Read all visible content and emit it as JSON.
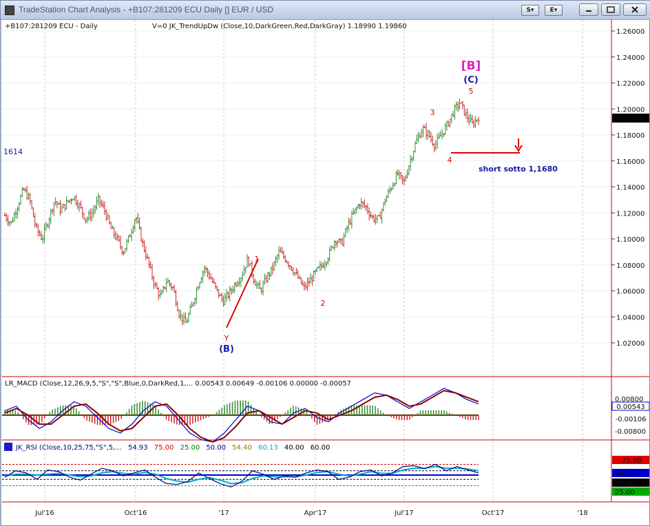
{
  "window": {
    "title": "TradeStation Chart Analysis - +B107:281209 ECU Daily [] EUR / USD",
    "buttons": [
      "S",
      "E"
    ]
  },
  "price_panel": {
    "symbol_label": "+B107:281209 ECU - Daily",
    "indicator_label": "V=0  JK_TrendUpDw (Close,10,DarkGreen,Red,DarkGray)   1.18990  1.19860",
    "left_label": "1614",
    "y_ticks": [
      "1.26000",
      "1.24000",
      "1.22000",
      "1.20000",
      "1.18000",
      "1.16000",
      "1.14000",
      "1.12000",
      "1.10000",
      "1.08000",
      "1.06000",
      "1.04000",
      "1.02000"
    ],
    "last_price": "1.19410",
    "annotations": {
      "big_b": "[B]",
      "wave_c": "(C)",
      "wave_b": "(B)",
      "y": "Y",
      "w1": "1",
      "w2": "2",
      "w3": "3",
      "w4": "4",
      "w5": "5",
      "short_text": "short sotto 1,1680"
    }
  },
  "macd_panel": {
    "label": "LR_MACD (Close,12,26,9,5,\"S\",\"S\",Blue,0,DarkRed,1,...   0.00543   0.00649   -0.00106   0.00000   -0.00057",
    "y_ticks": [
      "0.00800",
      "-0.00800"
    ],
    "value_badges": [
      {
        "text": "0.00543",
        "color": "#0000cc"
      },
      {
        "text": "-0.00106",
        "color": "#cc0000"
      }
    ]
  },
  "rsi_panel": {
    "label_parts": [
      {
        "text": "JK_RSI (Close,10,25,75,\"S\",5,...",
        "color": "#000080"
      },
      {
        "text": "54.93",
        "color": "#000080"
      },
      {
        "text": "75.00",
        "color": "#cc0000"
      },
      {
        "text": "25.00",
        "color": "#007700"
      },
      {
        "text": "50.00",
        "color": "#000080"
      },
      {
        "text": "54.40",
        "color": "#808000"
      },
      {
        "text": "60.13",
        "color": "#00aacc"
      },
      {
        "text": "40.00",
        "color": "#000000"
      },
      {
        "text": "60.00",
        "color": "#000000"
      }
    ],
    "value_badges": [
      {
        "text": "75.00",
        "color": "#cc0000"
      },
      {
        "text": "54.93",
        "color": "#0000cc"
      },
      {
        "text": "40.00",
        "color": "#000000"
      },
      {
        "text": "25.00",
        "color": "#007700"
      }
    ]
  },
  "x_axis": {
    "labels": [
      "Jul'16",
      "Oct'16",
      "'17",
      "Apr'17",
      "Jul'17",
      "Oct'17",
      "'18"
    ]
  },
  "chart_data": {
    "type": "ohlc",
    "title": "+B107:281209 ECU - Daily",
    "ylim": [
      1.0,
      1.265
    ],
    "x_labels": [
      "Jul'16",
      "Oct'16",
      "'17",
      "Apr'17",
      "Jul'17",
      "Oct'17",
      "'18"
    ],
    "y_ticks": [
      1.26,
      1.24,
      1.22,
      1.2,
      1.18,
      1.16,
      1.14,
      1.12,
      1.1,
      1.08,
      1.06,
      1.04,
      1.02
    ],
    "last_price": 1.1941,
    "close_path": [
      1.118,
      1.112,
      1.125,
      1.138,
      1.13,
      1.108,
      1.1,
      1.115,
      1.13,
      1.122,
      1.128,
      1.133,
      1.125,
      1.115,
      1.12,
      1.13,
      1.122,
      1.108,
      1.1,
      1.09,
      1.102,
      1.118,
      1.098,
      1.082,
      1.065,
      1.055,
      1.068,
      1.062,
      1.042,
      1.035,
      1.048,
      1.065,
      1.078,
      1.07,
      1.06,
      1.052,
      1.058,
      1.066,
      1.072,
      1.085,
      1.068,
      1.06,
      1.07,
      1.078,
      1.09,
      1.085,
      1.078,
      1.07,
      1.062,
      1.068,
      1.075,
      1.08,
      1.088,
      1.1,
      1.096,
      1.11,
      1.12,
      1.128,
      1.124,
      1.116,
      1.115,
      1.13,
      1.14,
      1.15,
      1.143,
      1.16,
      1.175,
      1.185,
      1.18,
      1.172,
      1.18,
      1.188,
      1.198,
      1.205,
      1.195,
      1.188,
      1.194
    ],
    "levels": [
      {
        "label": "short sotto 1,1680",
        "value": 1.168
      }
    ],
    "wave_labels": [
      {
        "text": "Y",
        "value": 1.037
      },
      {
        "text": "(B)",
        "value": 1.035
      },
      {
        "text": "1",
        "value": 1.083
      },
      {
        "text": "2",
        "value": 1.058
      },
      {
        "text": "3",
        "value": 1.192
      },
      {
        "text": "4",
        "value": 1.168
      },
      {
        "text": "5",
        "value": 1.205
      },
      {
        "text": "(C)",
        "value": 1.205
      },
      {
        "text": "[B]",
        "value": 1.205
      }
    ],
    "macd": {
      "label_values": [
        0.00543,
        0.00649,
        -0.00106,
        0.0,
        -0.00057
      ],
      "ylim": [
        -0.0105,
        0.0105
      ],
      "series": [
        {
          "name": "MACD",
          "color": "#0000cc",
          "values": [
            0.002,
            0.004,
            -0.002,
            -0.006,
            -0.003,
            0.002,
            0.006,
            0.004,
            -0.001,
            -0.006,
            -0.008,
            -0.004,
            0.002,
            0.006,
            0.004,
            -0.002,
            -0.008,
            -0.011,
            -0.012,
            -0.008,
            -0.002,
            0.004,
            0.002,
            -0.003,
            -0.004,
            0.001,
            0.003,
            -0.001,
            -0.003,
            0.001,
            0.004,
            0.007,
            0.01,
            0.009,
            0.006,
            0.003,
            0.006,
            0.009,
            0.012,
            0.01,
            0.007,
            0.005
          ]
        },
        {
          "name": "Signal",
          "color": "#8b0000",
          "values": [
            0.001,
            0.003,
            0.0,
            -0.004,
            -0.004,
            0.0,
            0.004,
            0.005,
            0.001,
            -0.004,
            -0.007,
            -0.006,
            -0.001,
            0.004,
            0.005,
            0.0,
            -0.006,
            -0.01,
            -0.012,
            -0.01,
            -0.005,
            0.001,
            0.002,
            -0.001,
            -0.004,
            -0.001,
            0.002,
            0.001,
            -0.002,
            0.0,
            0.002,
            0.005,
            0.008,
            0.009,
            0.007,
            0.004,
            0.005,
            0.008,
            0.011,
            0.01,
            0.008,
            0.006
          ]
        }
      ]
    },
    "rsi": {
      "ylim": [
        0,
        100
      ],
      "levels": [
        75,
        60,
        50,
        40,
        25
      ],
      "series": [
        {
          "name": "RSI",
          "color": "#000080",
          "values": [
            45,
            60,
            55,
            40,
            62,
            58,
            45,
            38,
            52,
            66,
            60,
            48,
            55,
            62,
            45,
            30,
            28,
            35,
            55,
            42,
            30,
            22,
            35,
            60,
            52,
            40,
            48,
            45,
            55,
            62,
            58,
            40,
            45,
            58,
            62,
            48,
            55,
            70,
            72,
            65,
            75,
            60,
            70,
            62,
            55
          ]
        },
        {
          "name": "Signal",
          "color": "#00aacc",
          "values": [
            48,
            52,
            52,
            50,
            52,
            54,
            50,
            46,
            48,
            55,
            58,
            54,
            52,
            56,
            52,
            42,
            36,
            33,
            40,
            44,
            38,
            30,
            32,
            42,
            48,
            46,
            46,
            46,
            50,
            56,
            58,
            52,
            48,
            52,
            58,
            54,
            54,
            62,
            66,
            66,
            70,
            66,
            66,
            64,
            60
          ]
        }
      ]
    }
  }
}
